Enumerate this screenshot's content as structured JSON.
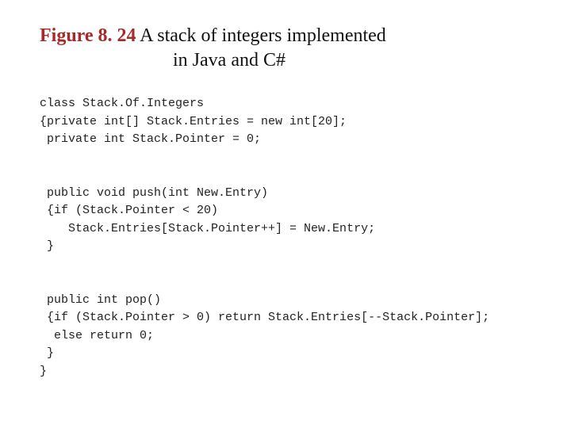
{
  "heading": {
    "figure_label": "Figure 8. 24",
    "caption_line_1": "  A stack of integers implemented",
    "caption_line_2": "in Java and C#"
  },
  "code": "class Stack.Of.Integers\n{private int[] Stack.Entries = new int[20];\n private int Stack.Pointer = 0;\n\n\n public void push(int New.Entry)\n {if (Stack.Pointer < 20)\n    Stack.Entries[Stack.Pointer++] = New.Entry;\n }\n\n\n public int pop()\n {if (Stack.Pointer > 0) return Stack.Entries[--Stack.Pointer];\n  else return 0;\n }\n}"
}
